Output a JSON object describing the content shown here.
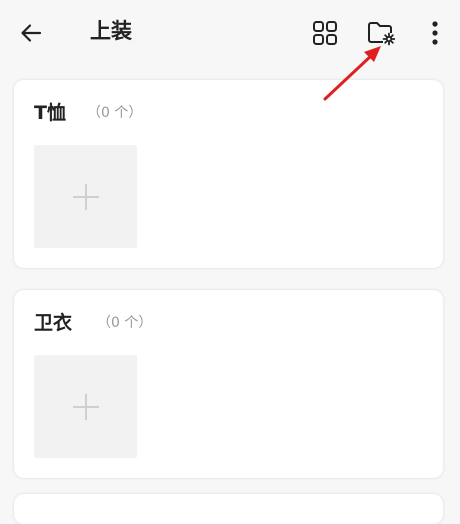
{
  "header": {
    "title": "上装"
  },
  "categories": [
    {
      "name": "T恤",
      "count": "（0 个）"
    },
    {
      "name": "卫衣",
      "count": "（0 个）"
    }
  ],
  "colors": {
    "annotation_arrow": "#e02020",
    "placeholder_bg": "#f2f2f2",
    "muted_text": "#999999"
  },
  "icons": [
    "back-arrow-icon",
    "grid-icon",
    "folder-settings-icon",
    "more-vertical-icon",
    "plus-icon"
  ]
}
